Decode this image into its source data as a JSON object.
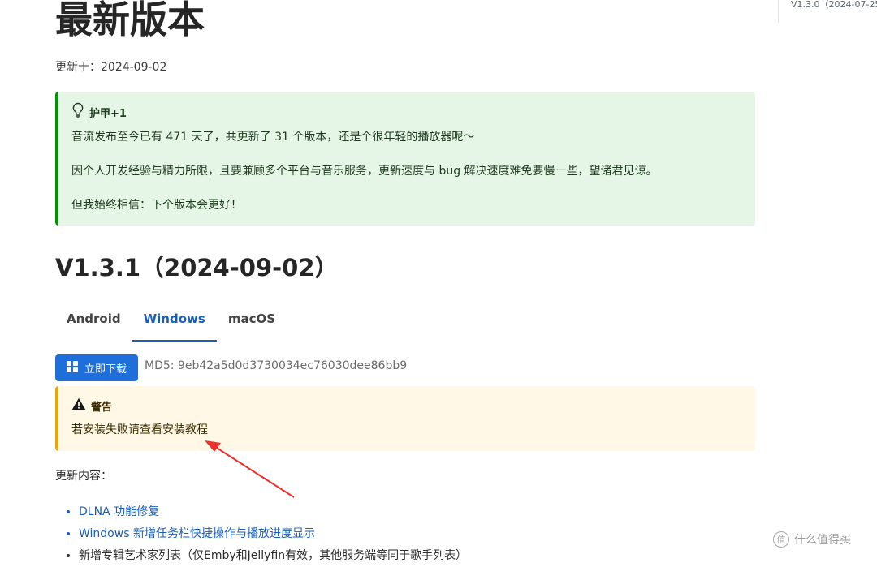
{
  "page": {
    "title": "最新版本",
    "updated": "更新于：2024-09-02",
    "right_rail_item": "V1.3.0（2024-07-25"
  },
  "tip": {
    "icon": "lightbulb-icon",
    "heading": "护甲+1",
    "lines": [
      "音流发布至今已有 471 天了，共更新了 31 个版本，还是个很年轻的播放器呢～",
      "因个人开发经验与精力所限，且要兼顾多个平台与音乐服务，更新速度与 bug 解决速度难免要慢一些，望诸君见谅。",
      "但我始终相信：下个版本会更好！"
    ],
    "accent": "#009400"
  },
  "version": {
    "title": "V1.3.1（2024-09-02）",
    "tabs": [
      "Android",
      "Windows",
      "macOS"
    ],
    "active_tab": "Windows",
    "download_label": "立即下载",
    "download_icon": "windows-icon",
    "md5": "MD5: 9eb42a5d0d3730034ec76030dee86bb9",
    "accent": "#1e6fd9"
  },
  "warning": {
    "icon": "warning-triangle-icon",
    "heading": "警告",
    "text": "若安装失败请查看安装教程",
    "accent": "#e6a700"
  },
  "annotation": {
    "arrow_color": "#e8322b"
  },
  "changes": {
    "label": "更新内容：",
    "items": [
      "DLNA 功能修复",
      "Windows 新增任务栏快捷操作与播放进度显示",
      "新增专辑艺术家列表（仅Emby和Jellyfin有效，其他服务端等同于歌手列表）"
    ]
  },
  "watermark": {
    "logo_glyph": "值",
    "text": "什么值得买"
  }
}
